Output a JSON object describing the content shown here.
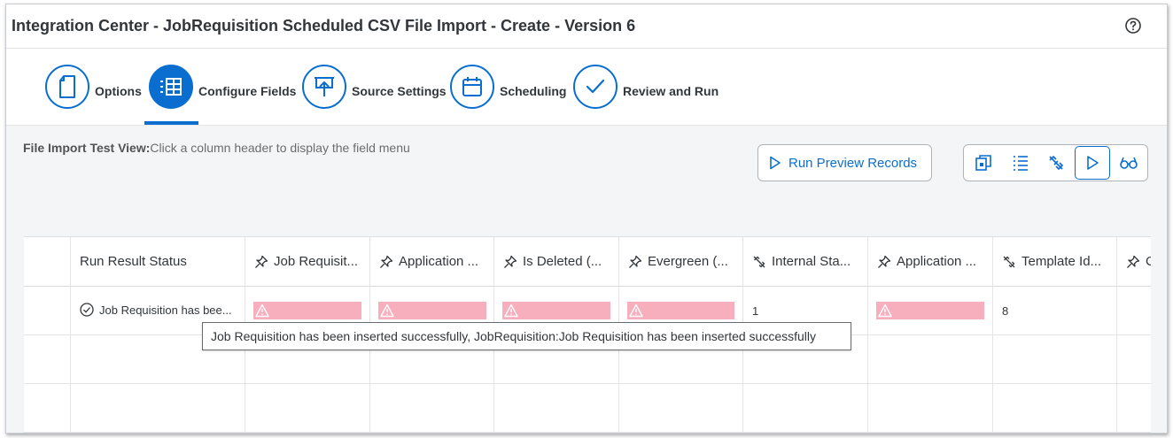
{
  "window": {
    "title": "Integration Center - JobRequisition Scheduled CSV File Import - Create - Version 6",
    "help_icon": "question-circle-icon"
  },
  "wizard": {
    "active_step": 1,
    "steps": [
      {
        "label": "Options",
        "icon": "document-icon"
      },
      {
        "label": "Configure Fields",
        "icon": "table-grid-icon"
      },
      {
        "label": "Source Settings",
        "icon": "upload-icon"
      },
      {
        "label": "Scheduling",
        "icon": "calendar-icon"
      },
      {
        "label": "Review and Run",
        "icon": "checkmark-icon"
      }
    ]
  },
  "content": {
    "hint_bold": "File Import Test View:",
    "hint_text": "Click a column header to display the field menu",
    "run_preview_label": "Run Preview Records",
    "toolbar_icons": [
      "mapping-icon",
      "list-icon",
      "unlinked-icon",
      "play-icon",
      "preview-glasses-icon"
    ],
    "toolbar_selected": "play-icon"
  },
  "grid": {
    "columns": [
      {
        "label": "",
        "icon": ""
      },
      {
        "label": "Run Result Status",
        "icon": ""
      },
      {
        "label": "Job Requisit...",
        "icon": "pin-icon"
      },
      {
        "label": "Application ...",
        "icon": "pin-icon"
      },
      {
        "label": "Is Deleted (...",
        "icon": "pin-icon"
      },
      {
        "label": "Evergreen (...",
        "icon": "pin-icon"
      },
      {
        "label": "Internal Sta...",
        "icon": "unlink-icon"
      },
      {
        "label": "Application ...",
        "icon": "pin-icon"
      },
      {
        "label": "Template Id...",
        "icon": "unlink-icon"
      },
      {
        "label": "C",
        "icon": "pin-icon"
      }
    ],
    "row1": {
      "status_text": "Job Requisition has bee...",
      "status_icon": "check-circle-icon",
      "internal_status": "1",
      "template_id": "8",
      "warning_icon": "warning-triangle-icon"
    }
  },
  "tooltip": {
    "text": "Job Requisition has been inserted successfully, JobRequisition:Job Requisition has been inserted successfully"
  },
  "colors": {
    "accent": "#0a6ed1",
    "warning_fill": "#f7aebd"
  }
}
